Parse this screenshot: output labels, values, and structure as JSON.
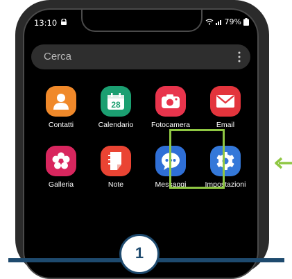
{
  "status": {
    "time": "13:10",
    "battery": "79%"
  },
  "search": {
    "placeholder": "Cerca"
  },
  "apps": [
    {
      "label": "Contatti",
      "icon": "contacts-icon",
      "color": "#f0892a"
    },
    {
      "label": "Calendario",
      "icon": "calendar-icon",
      "color": "#1b9f71",
      "day": "28"
    },
    {
      "label": "Fotocamera",
      "icon": "camera-icon",
      "color": "#e8344c"
    },
    {
      "label": "Email",
      "icon": "email-icon",
      "color": "#e3343c"
    },
    {
      "label": "Galleria",
      "icon": "gallery-icon",
      "color": "#d8265e"
    },
    {
      "label": "Note",
      "icon": "notes-icon",
      "color": "#ea4433"
    },
    {
      "label": "Messaggi",
      "icon": "messages-icon",
      "color": "#2f6fd6"
    },
    {
      "label": "Impostazioni",
      "icon": "settings-icon",
      "color": "#3478d9"
    }
  ],
  "step": {
    "number": "1",
    "color": "#1e4a6e"
  },
  "highlight_color": "#8fc743"
}
